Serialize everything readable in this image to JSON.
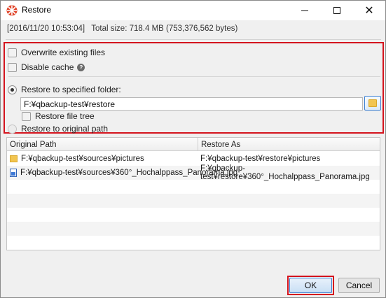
{
  "window": {
    "title": "Restore"
  },
  "info": {
    "timestamp": "[2016/11/20 10:53:04]",
    "total_size": "Total size: 718.4 MB (753,376,562 bytes)"
  },
  "options": {
    "overwrite": {
      "label": "Overwrite existing files",
      "checked": false
    },
    "disable_cache": {
      "label": "Disable cache",
      "checked": false
    },
    "restore_to_folder": {
      "label": "Restore to specified folder:",
      "selected": true
    },
    "folder_path": "F:¥qbackup-test¥restore",
    "restore_file_tree": {
      "label": "Restore file tree",
      "checked": false
    },
    "restore_to_original": {
      "label": "Restore to original path",
      "selected": false
    }
  },
  "table": {
    "columns": [
      "Original Path",
      "Restore As"
    ],
    "rows": [
      {
        "icon": "folder-icon",
        "original": "F:¥qbackup-test¥sources¥pictures",
        "restore_as": "F:¥qbackup-test¥restore¥pictures"
      },
      {
        "icon": "image-file-icon",
        "original": "F:¥qbackup-test¥sources¥360°_Hochalppass_Panorama.jpg",
        "restore_as": "F:¥qbackup-test¥restore¥360°_Hochalppass_Panorama.jpg"
      }
    ]
  },
  "buttons": {
    "ok": "OK",
    "cancel": "Cancel"
  },
  "colors": {
    "highlight": "#d4141e",
    "accent": "#3c7fd0",
    "folder": "#f2c550"
  }
}
